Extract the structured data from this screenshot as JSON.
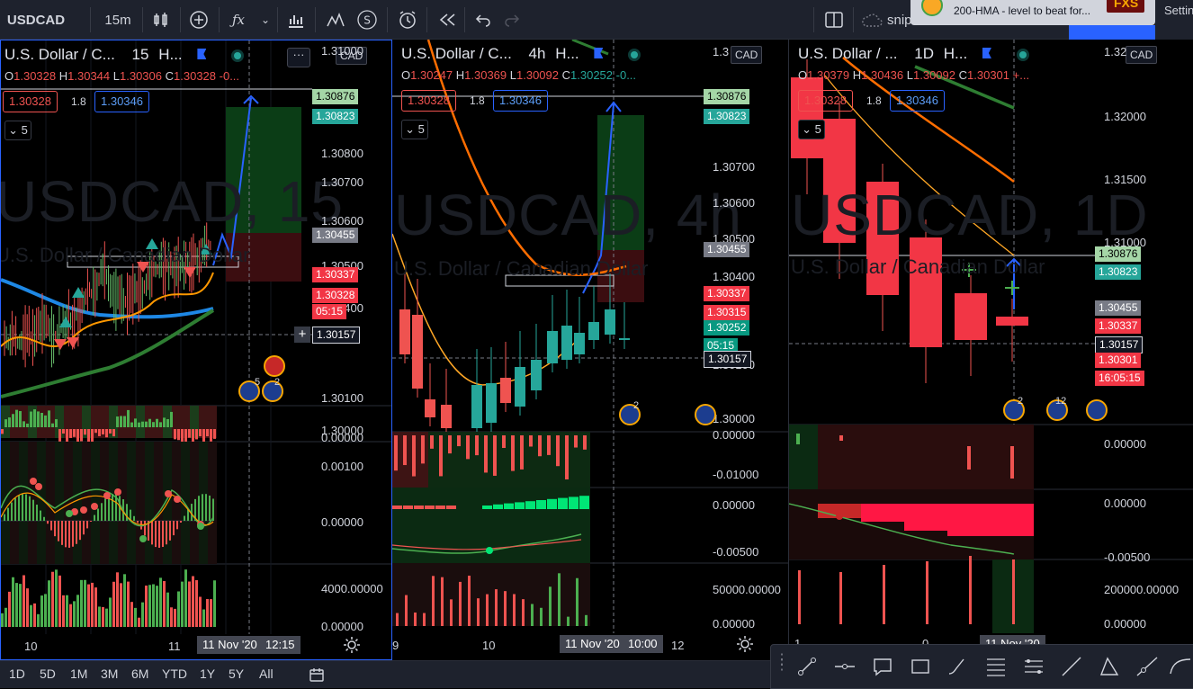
{
  "topbar": {
    "symbol": "USDCAD",
    "interval": "15m",
    "snip_label": "snip",
    "settings_label": "Settin"
  },
  "notification": {
    "text": "200-HMA - level to beat for...",
    "badge": "FXS"
  },
  "panels": [
    {
      "legend_name": "U.S. Dollar / C...",
      "legend_interval": "15",
      "legend_extra": "H...",
      "ohlc": {
        "o": "1.30328",
        "h": "1.30344",
        "l": "1.30306",
        "c": "1.30328",
        "chg": "-0..."
      },
      "sell_price": "1.30328",
      "spread": "1.8",
      "buy_price": "1.30346",
      "collapse_count": "5",
      "watermark": "USDCAD, 15",
      "watermark_sub": "U.S. Dollar / Canadian Dollar",
      "currency": "CAD",
      "more_label": "···",
      "price_axis": [
        "1.31000",
        "1.30800",
        "1.30700",
        "1.30600",
        "1.30500",
        "1.30400",
        "1.30100",
        "1.30000"
      ],
      "price_tags": [
        {
          "label": "1.30876",
          "color": "#a5d6a7",
          "text": "#000"
        },
        {
          "label": "1.30823",
          "color": "#26a69a",
          "text": "#fff"
        },
        {
          "label": "1.30455",
          "color": "#787b86",
          "text": "#fff"
        },
        {
          "label": "1.30337",
          "color": "#f23645",
          "text": "#fff"
        },
        {
          "label": "1.30328",
          "color": "#f23645",
          "text": "#fff"
        },
        {
          "label": "05:15",
          "color": "#f23645",
          "text": "#fff"
        },
        {
          "label": "1.30157",
          "color": "#131722",
          "text": "#fff"
        }
      ],
      "osc_axis": [
        "0.00000",
        "0.00100",
        "0.00000"
      ],
      "vol_axis": [
        "4000.00000",
        "0.00000"
      ],
      "time_labels": [
        "10",
        "11"
      ],
      "time_tag": "11 Nov '20",
      "time_tag2": "12:15",
      "event_counts": [
        "5",
        "2"
      ]
    },
    {
      "legend_name": "U.S. Dollar / C...",
      "legend_interval": "4h",
      "legend_extra": "H...",
      "ohlc": {
        "o": "1.30247",
        "h": "1.30369",
        "l": "1.30092",
        "c": "1.30252",
        "chg": "-0..."
      },
      "sell_price": "1.30328",
      "spread": "1.8",
      "buy_price": "1.30346",
      "collapse_count": "5",
      "watermark": "USDCAD, 4h",
      "watermark_sub": "U.S. Dollar / Canadian Dollar",
      "currency": "CAD",
      "price_axis": [
        "1.3",
        "1.30700",
        "1.30600",
        "1.30500",
        "1.30400",
        "1.30100",
        "1.30000"
      ],
      "price_tags": [
        {
          "label": "1.30876",
          "color": "#a5d6a7",
          "text": "#000"
        },
        {
          "label": "1.30823",
          "color": "#26a69a",
          "text": "#fff"
        },
        {
          "label": "1.30455",
          "color": "#787b86",
          "text": "#fff"
        },
        {
          "label": "1.30337",
          "color": "#f23645",
          "text": "#fff"
        },
        {
          "label": "1.30315",
          "color": "#f23645",
          "text": "#fff"
        },
        {
          "label": "1.30252",
          "color": "#089981",
          "text": "#fff"
        },
        {
          "label": "05:15",
          "color": "#089981",
          "text": "#fff"
        },
        {
          "label": "1.30157",
          "color": "#131722",
          "text": "#fff"
        }
      ],
      "osc_axis": [
        "0.00000",
        "-0.01000",
        "0.00000",
        "-0.00500"
      ],
      "vol_axis": [
        "50000.00000",
        "0.00000"
      ],
      "time_labels": [
        "9",
        "10",
        "12"
      ],
      "time_tag": "11 Nov '20",
      "time_tag2": "10:00",
      "event_counts": [
        "2"
      ]
    },
    {
      "legend_name": "U.S. Dollar / ...",
      "legend_interval": "1D",
      "legend_extra": "H...",
      "ohlc": {
        "o": "1.30379",
        "h": "1.30436",
        "l": "1.30092",
        "c": "1.30301",
        "chg": "+..."
      },
      "sell_price": "1.30328",
      "spread": "1.8",
      "buy_price": "1.30346",
      "collapse_count": "5",
      "watermark": "USDCAD, 1D",
      "watermark_sub": "U.S. Dollar / Canadian Dollar",
      "currency": "CAD",
      "price_axis": [
        "1.32",
        "1.32000",
        "1.31500",
        "1.31000"
      ],
      "price_tags": [
        {
          "label": "1.30876",
          "color": "#a5d6a7",
          "text": "#000"
        },
        {
          "label": "1.30823",
          "color": "#26a69a",
          "text": "#fff"
        },
        {
          "label": "1.30455",
          "color": "#787b86",
          "text": "#fff"
        },
        {
          "label": "1.30337",
          "color": "#f23645",
          "text": "#fff"
        },
        {
          "label": "1.30157",
          "color": "#131722",
          "text": "#fff"
        },
        {
          "label": "1.30301",
          "color": "#f23645",
          "text": "#fff"
        },
        {
          "label": "16:05:15",
          "color": "#f23645",
          "text": "#fff"
        }
      ],
      "osc_axis": [
        "0.00000",
        "0.00000",
        "-0.00500"
      ],
      "vol_axis": [
        "200000.00000",
        "0.00000"
      ],
      "time_labels": [
        "1",
        "0"
      ],
      "time_tag": "11 Nov '20",
      "event_counts": [
        "2",
        "12"
      ]
    }
  ],
  "ranges": [
    "1D",
    "5D",
    "1M",
    "3M",
    "6M",
    "YTD",
    "1Y",
    "5Y",
    "All"
  ]
}
